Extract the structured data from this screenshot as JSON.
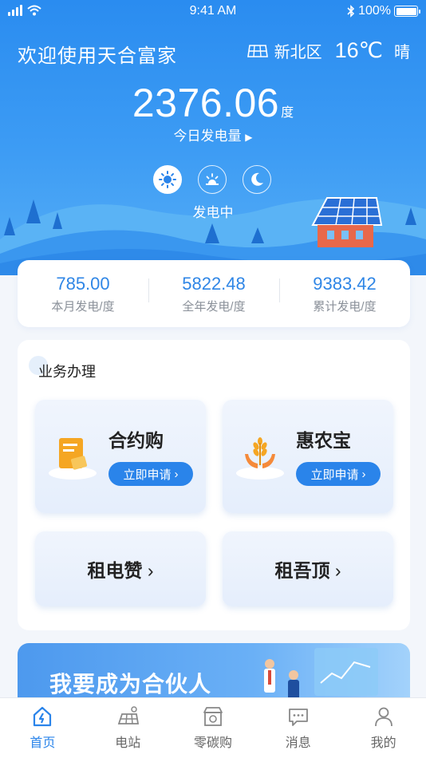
{
  "status": {
    "time": "9:41 AM",
    "battery": "100%"
  },
  "header": {
    "welcome": "欢迎使用天合富家",
    "district": "新北区",
    "temperature": "16℃",
    "weather": "晴",
    "today_value": "2376.06",
    "today_unit": "度",
    "today_label": "今日发电量",
    "status_text": "发电中"
  },
  "stats": [
    {
      "value": "785.00",
      "label": "本月发电/度"
    },
    {
      "value": "5822.48",
      "label": "全年发电/度"
    },
    {
      "value": "9383.42",
      "label": "累计发电/度"
    }
  ],
  "business": {
    "title": "业务办理",
    "tiles": [
      {
        "name": "合约购",
        "button": "立即申请"
      },
      {
        "name": "惠农宝",
        "button": "立即申请"
      },
      {
        "name": "租电赞"
      },
      {
        "name": "租吾顶"
      }
    ]
  },
  "partner": {
    "text": "我要成为合伙人"
  },
  "tabs": [
    {
      "label": "首页",
      "icon": "home-icon",
      "active": true
    },
    {
      "label": "电站",
      "icon": "power-station-icon",
      "active": false
    },
    {
      "label": "零碳购",
      "icon": "shop-icon",
      "active": false
    },
    {
      "label": "消息",
      "icon": "message-icon",
      "active": false
    },
    {
      "label": "我的",
      "icon": "profile-icon",
      "active": false
    }
  ],
  "colors": {
    "primary": "#2a84ea",
    "hero": "#3d9cf4",
    "stat_value": "#2f86e6"
  }
}
